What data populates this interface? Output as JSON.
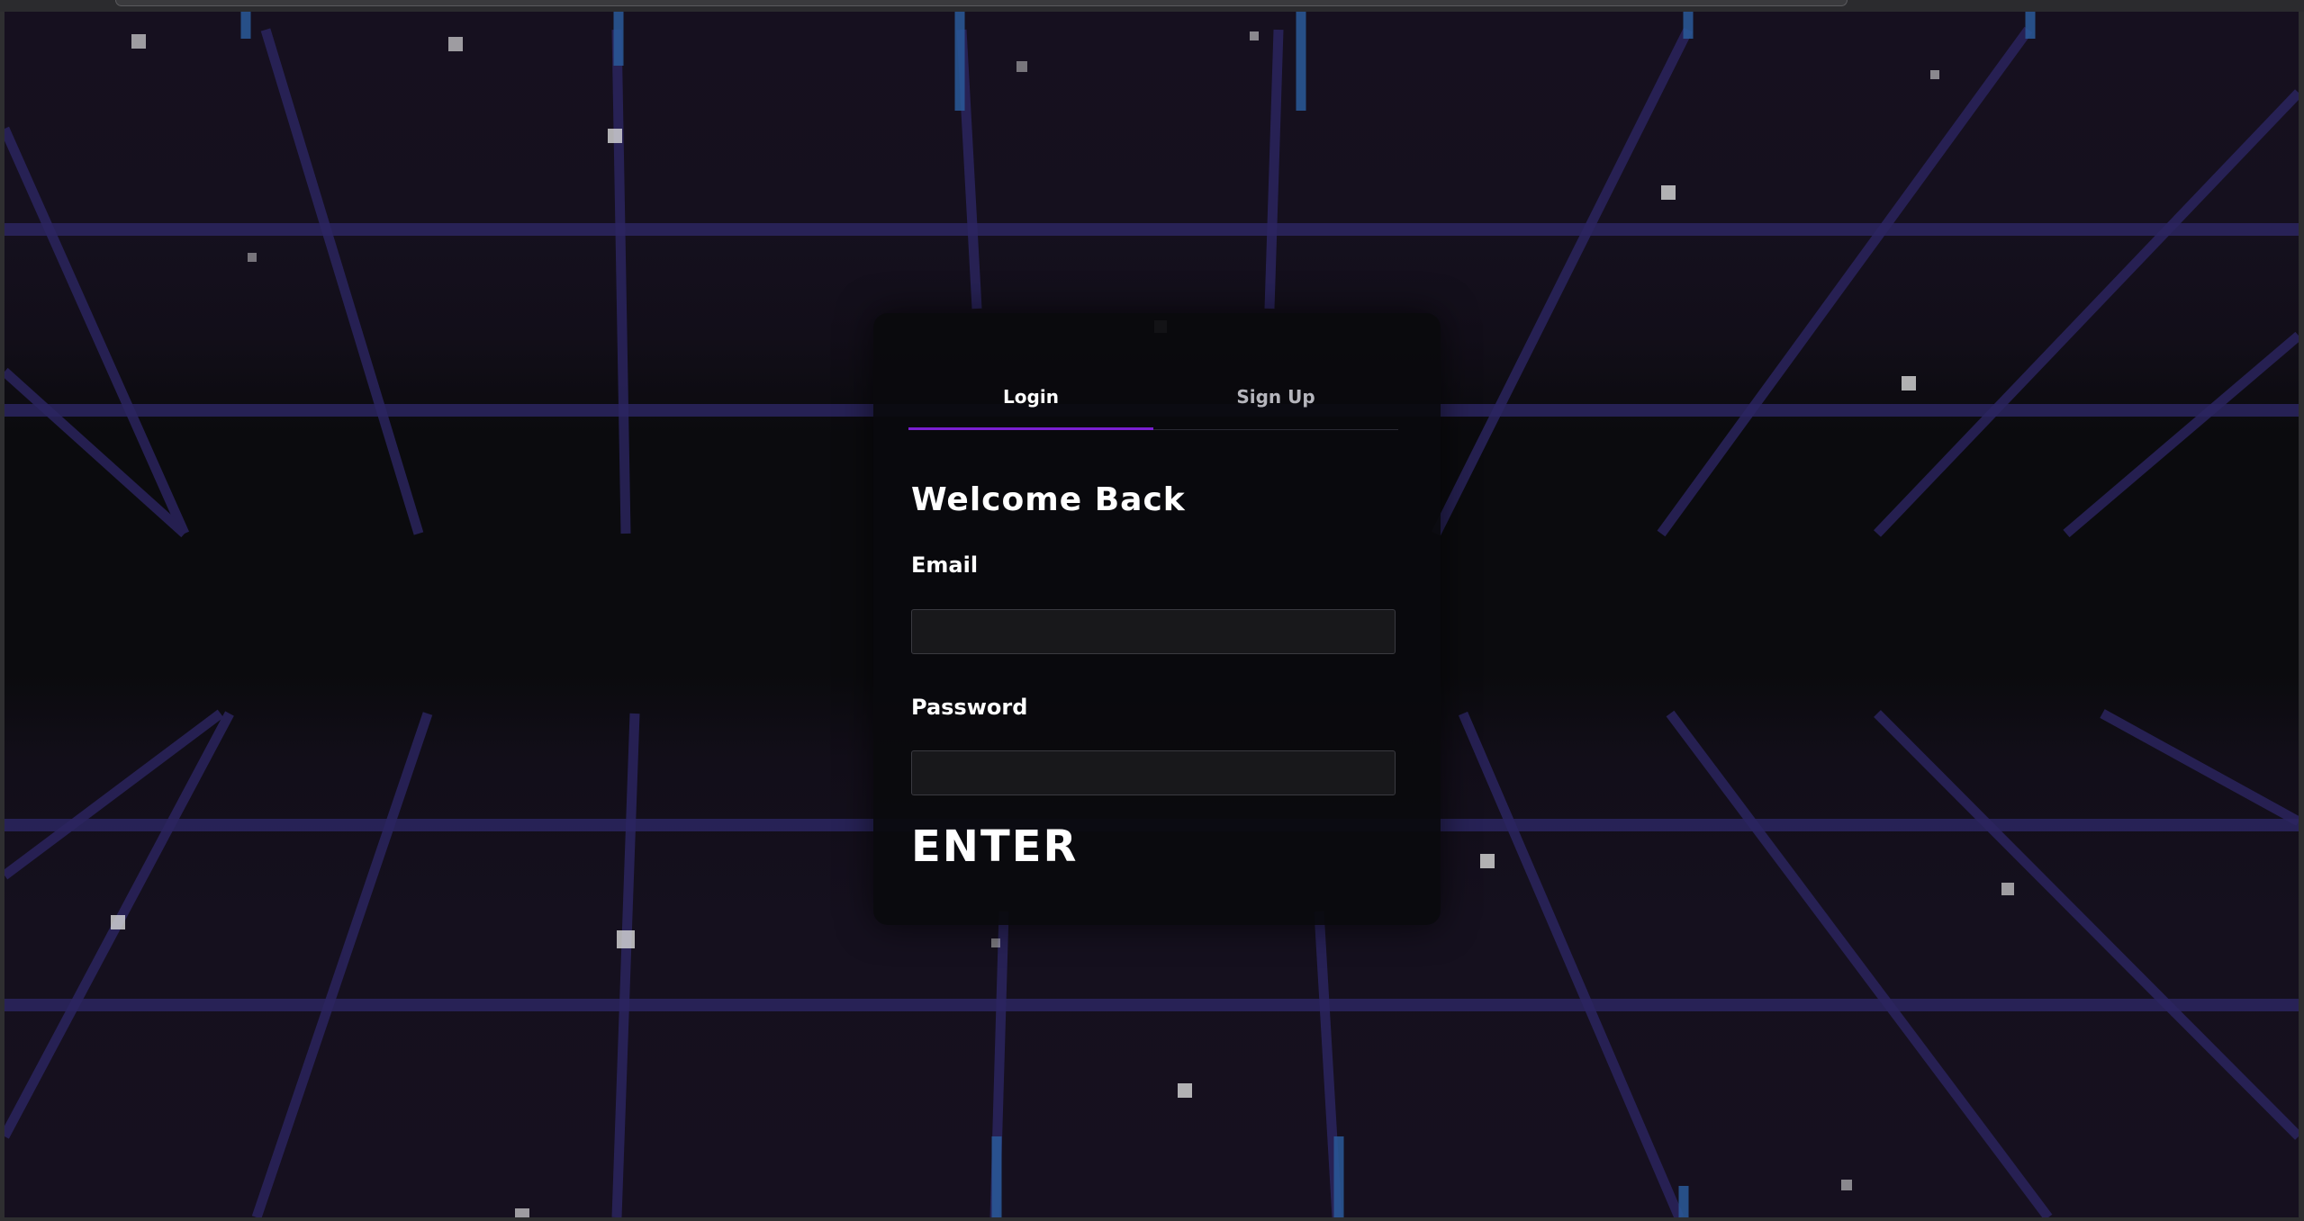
{
  "auth": {
    "tabs": {
      "login": "Login",
      "signup": "Sign Up"
    },
    "heading": "Welcome Back",
    "email": {
      "label": "Email",
      "value": "",
      "placeholder": ""
    },
    "password": {
      "label": "Password",
      "value": "",
      "placeholder": ""
    },
    "submit_label": "ENTER"
  },
  "colors": {
    "background": "#0b0b0e",
    "grid_dark": "#16101f",
    "grid_line": "#2c2560",
    "grid_line_blue": "#2a5a9a",
    "accent": "#7a1fd0",
    "star": "#d9d9d9"
  }
}
